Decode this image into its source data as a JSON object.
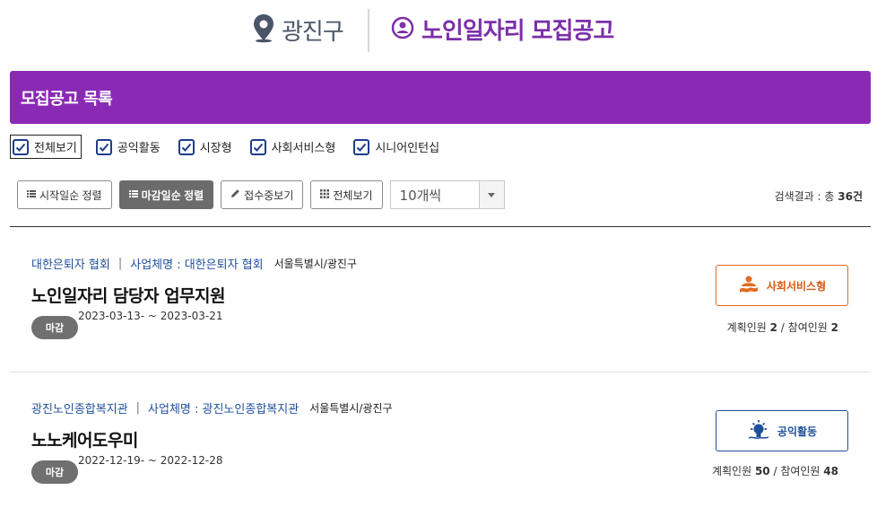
{
  "header": {
    "district": "광진구",
    "site_title": "노인일자리 모집공고"
  },
  "banner": {
    "title": "모집공고 목록"
  },
  "filters": [
    {
      "label": "전체보기",
      "checked": true
    },
    {
      "label": "공익활동",
      "checked": true
    },
    {
      "label": "시장형",
      "checked": true
    },
    {
      "label": "사회서비스형",
      "checked": true
    },
    {
      "label": "시니어인턴십",
      "checked": true
    }
  ],
  "toolbar": {
    "sort_start": "시작일순 정렬",
    "sort_end": "마감일순 정렬",
    "view_open": "접수중보기",
    "view_all": "전체보기",
    "page_size": "10개씩",
    "result_prefix": "검색결과 : 총 ",
    "result_count": "36건"
  },
  "items": [
    {
      "org": "대한은퇴자 협회",
      "business": "사업체명 : 대한은퇴자 협회",
      "location": "서울특별시/광진구",
      "title": "노인일자리 담당자 업무지원",
      "status": "마감",
      "date": "2023-03-13- ~ 2023-03-21",
      "type": "사회서비스형",
      "planned_label": "계획인원 ",
      "planned": "2",
      "joined_label": " / 참여인원 ",
      "joined": "2"
    },
    {
      "org": "광진노인종합복지관",
      "business": "사업체명 : 광진노인종합복지관",
      "location": "서울특별시/광진구",
      "title": "노노케어도우미",
      "status": "마감",
      "date": "2022-12-19- ~ 2022-12-28",
      "type": "공익활동",
      "planned_label": "계획인원 ",
      "planned": "50",
      "joined_label": " / 참여인원 ",
      "joined": "48"
    }
  ],
  "colors": {
    "brand_purple": "#8a2ab4",
    "link_blue": "#1f4f9c",
    "social_orange": "#e56a22"
  }
}
